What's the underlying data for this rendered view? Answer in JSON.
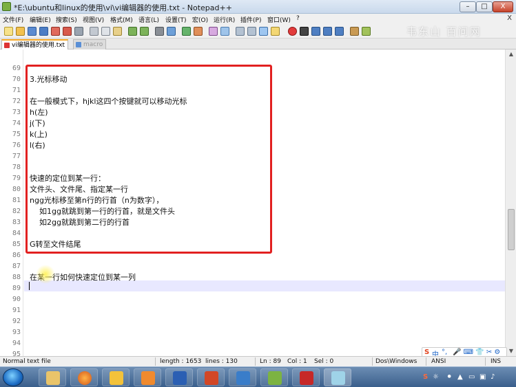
{
  "window": {
    "title": "*E:\\ubuntu和linux的使用\\vi\\vi编辑器的使用.txt - Notepad++",
    "buttons": {
      "minimize": "–",
      "maximize": "□",
      "close": "X"
    }
  },
  "menu": {
    "items": [
      "文件(F)",
      "编辑(E)",
      "搜索(S)",
      "视图(V)",
      "格式(M)",
      "语言(L)",
      "设置(T)",
      "宏(O)",
      "运行(R)",
      "插件(P)",
      "窗口(W)",
      "?"
    ],
    "close": "X"
  },
  "watermark": "韦东山 百问网",
  "tabs": [
    {
      "label": "vi编辑器的使用.txt",
      "active": true
    },
    {
      "label": "macro",
      "active": false
    }
  ],
  "editor": {
    "lines": [
      {
        "num": "69",
        "text": ""
      },
      {
        "num": "70",
        "text": "3.光标移动"
      },
      {
        "num": "71",
        "text": ""
      },
      {
        "num": "72",
        "text": "在一般模式下，hjkl这四个按键就可以移动光标"
      },
      {
        "num": "73",
        "text": "h(左)"
      },
      {
        "num": "74",
        "text": "j(下)"
      },
      {
        "num": "75",
        "text": "k(上)"
      },
      {
        "num": "76",
        "text": "l(右)"
      },
      {
        "num": "77",
        "text": ""
      },
      {
        "num": "78",
        "text": ""
      },
      {
        "num": "79",
        "text": "快速的定位到某一行："
      },
      {
        "num": "80",
        "text": "文件头、文件尾、指定某一行"
      },
      {
        "num": "81",
        "text": "ngg光标移至第n行的行首（n为数字），"
      },
      {
        "num": "82",
        "text": "    如1gg就跳到第一行的行首，就是文件头"
      },
      {
        "num": "83",
        "text": "    如2gg就跳到第二行的行首"
      },
      {
        "num": "84",
        "text": ""
      },
      {
        "num": "85",
        "text": "G转至文件结尾"
      },
      {
        "num": "86",
        "text": ""
      },
      {
        "num": "87",
        "text": ""
      },
      {
        "num": "88",
        "text": "在某一行如何快速定位到某一列"
      },
      {
        "num": "89",
        "text": ""
      },
      {
        "num": "90",
        "text": ""
      },
      {
        "num": "91",
        "text": ""
      },
      {
        "num": "92",
        "text": ""
      },
      {
        "num": "93",
        "text": ""
      },
      {
        "num": "94",
        "text": ""
      },
      {
        "num": "95",
        "text": ""
      }
    ]
  },
  "ime": {
    "logo": "S",
    "mode": "中",
    "punct": "°,",
    "items": "🎤 ⌨ 👕 ✂ ⚙"
  },
  "status": {
    "filetype": "Normal text file",
    "length": "length : 1653",
    "lines": "lines : 130",
    "ln": "Ln : 89",
    "col": "Col : 1",
    "sel": "Sel : 0",
    "eol": "Dos\\Windows",
    "encoding": "ANSI",
    "mode": "INS"
  },
  "taskbar": {
    "apps": [
      "explorer",
      "firefox",
      "tool",
      "pdf",
      "word",
      "powerpoint",
      "app-y",
      "chart",
      "media",
      "notepad"
    ]
  },
  "colors": {
    "highlight_box": "#e22020",
    "current_line": "#e8e8ff",
    "tab_accent": "#f5a623"
  }
}
